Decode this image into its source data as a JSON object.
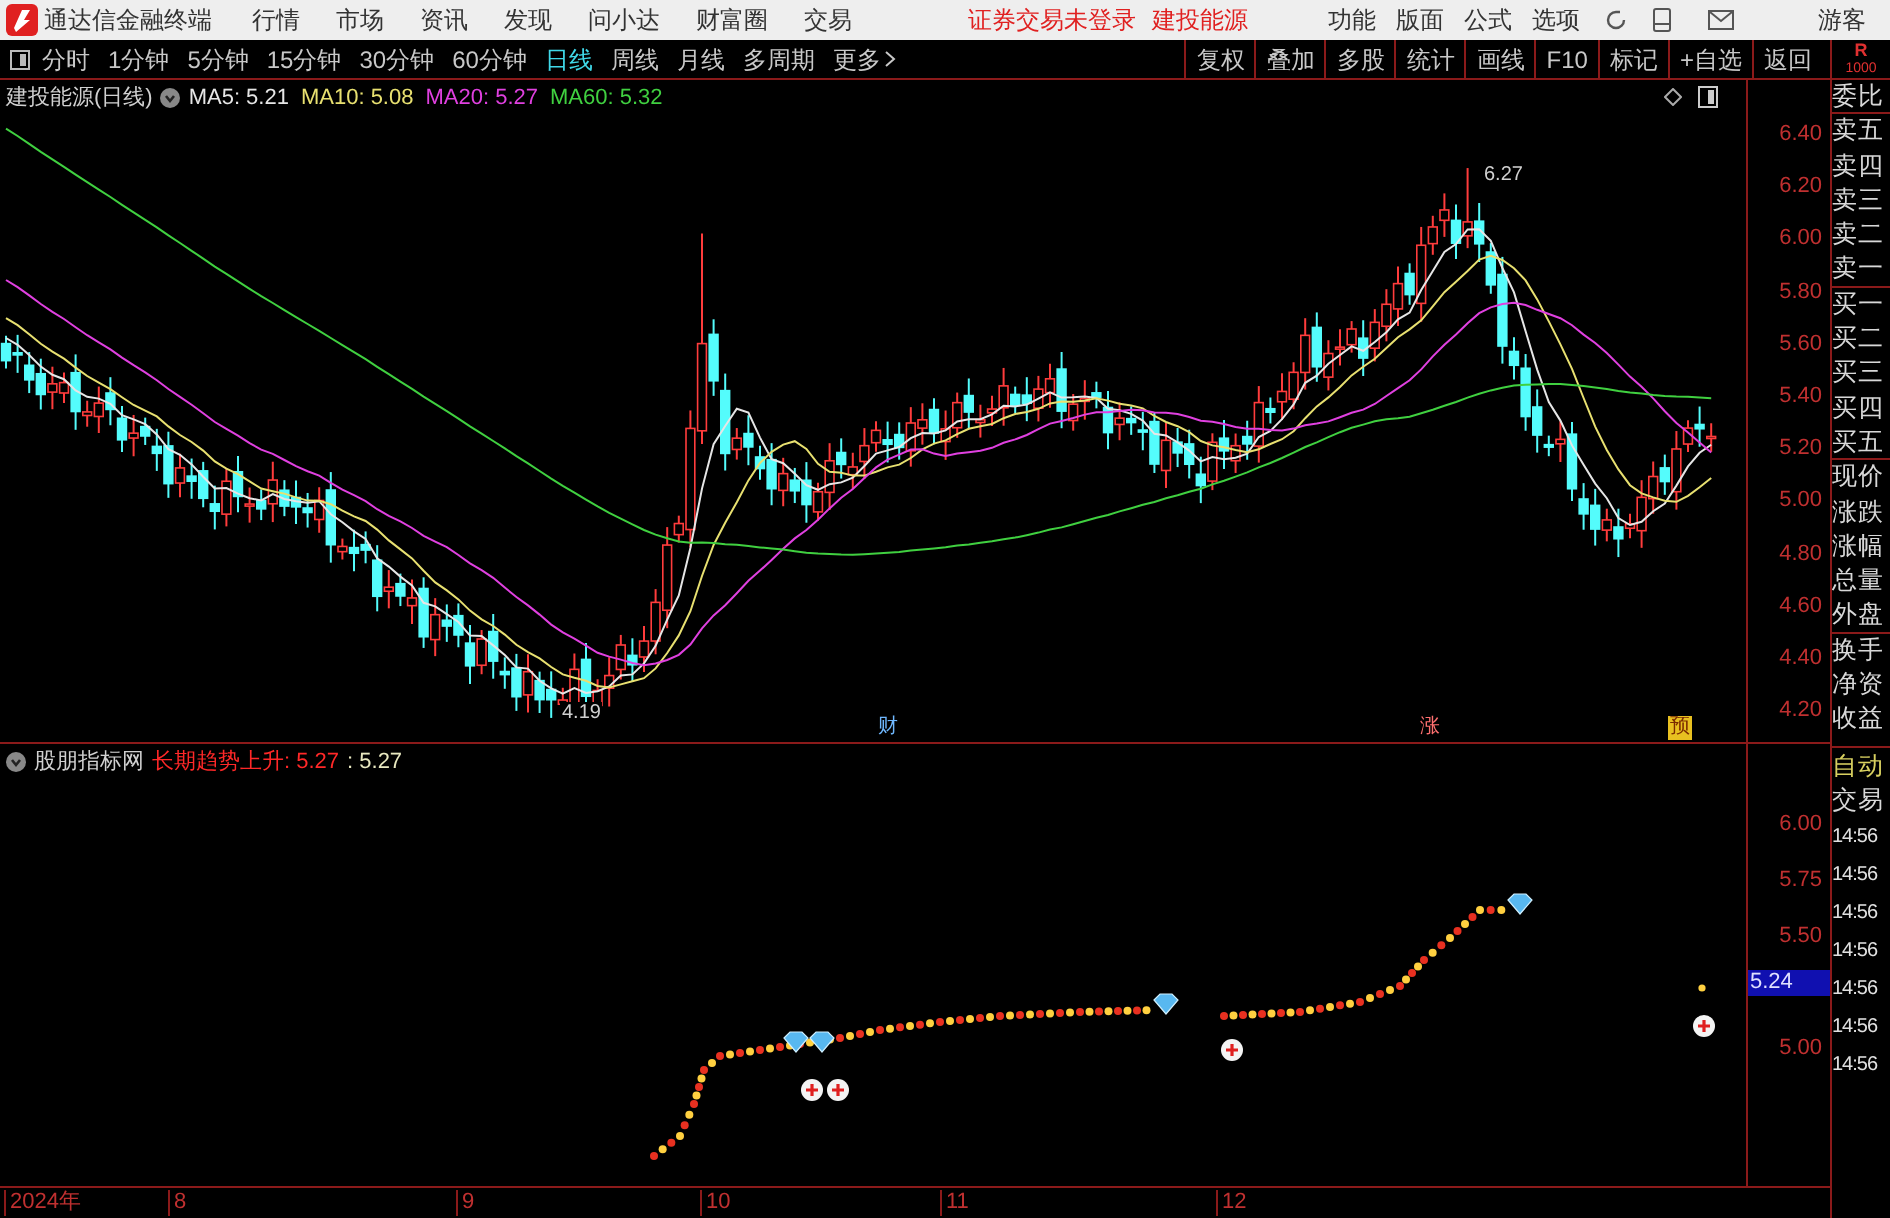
{
  "menu_bar": {
    "app_title": "通达信金融终端",
    "menus": [
      "行情",
      "市场",
      "资讯",
      "发现",
      "问小达",
      "财富圈",
      "交易"
    ],
    "notices": [
      "证券交易未登录",
      "建投能源"
    ],
    "tools": [
      "功能",
      "版面",
      "公式",
      "选项"
    ],
    "user": "游客"
  },
  "period_tabs": [
    {
      "label": "分时",
      "selected": false
    },
    {
      "label": "1分钟",
      "selected": false
    },
    {
      "label": "5分钟",
      "selected": false
    },
    {
      "label": "15分钟",
      "selected": false
    },
    {
      "label": "30分钟",
      "selected": false
    },
    {
      "label": "60分钟",
      "selected": false
    },
    {
      "label": "日线",
      "selected": true
    },
    {
      "label": "周线",
      "selected": false
    },
    {
      "label": "月线",
      "selected": false
    },
    {
      "label": "多周期",
      "selected": false
    }
  ],
  "more_menu": "更多",
  "toolbar_buttons": [
    "复权",
    "叠加",
    "多股",
    "统计",
    "画线",
    "F10",
    "标记",
    "+自选",
    "返回"
  ],
  "corner_badge": {
    "letter": "R",
    "number": "1000"
  },
  "price_panel": {
    "title": "建投能源(日线)",
    "moving_averages": [
      {
        "label": "MA5: 5.21",
        "color": "#e6e6e6"
      },
      {
        "label": "MA10: 5.08",
        "color": "#e8e070"
      },
      {
        "label": "MA20: 5.27",
        "color": "#e040e0"
      },
      {
        "label": "MA60: 5.32",
        "color": "#40d040"
      }
    ],
    "axis_labels": [
      "6.40",
      "6.20",
      "6.00",
      "5.80",
      "5.60",
      "5.40",
      "5.20",
      "5.00",
      "4.80",
      "4.60",
      "4.40",
      "4.20"
    ],
    "high_label": "6.27",
    "low_label": "4.19",
    "event_markers": [
      {
        "label": "财",
        "color": "#6fb8ff"
      },
      {
        "label": "涨",
        "color": "#ff7070"
      },
      {
        "label": "预",
        "color": "#e8c020"
      }
    ]
  },
  "indicator_panel": {
    "title": "股朋指标网",
    "signal_label": "长期趋势上升: 5.27",
    "value_label": ": 5.27",
    "axis_labels": [
      "6.00",
      "5.75",
      "5.50",
      "5.00"
    ],
    "current_badge": "5.24"
  },
  "date_axis": [
    "2024年",
    "8",
    "9",
    "10",
    "11",
    "12"
  ],
  "quote_labels": [
    "委比",
    "卖五",
    "卖四",
    "卖三",
    "卖二",
    "卖一",
    "买一",
    "买二",
    "买三",
    "买四",
    "买五",
    "现价",
    "涨跌",
    "涨幅",
    "总量",
    "外盘",
    "换手",
    "净资",
    "收益"
  ],
  "trade_section": {
    "title": "自动",
    "subtitle": "交易",
    "times": [
      "14:56",
      "14:56",
      "14:56",
      "14:56",
      "14:56",
      "14:56",
      "14:56"
    ]
  }
}
